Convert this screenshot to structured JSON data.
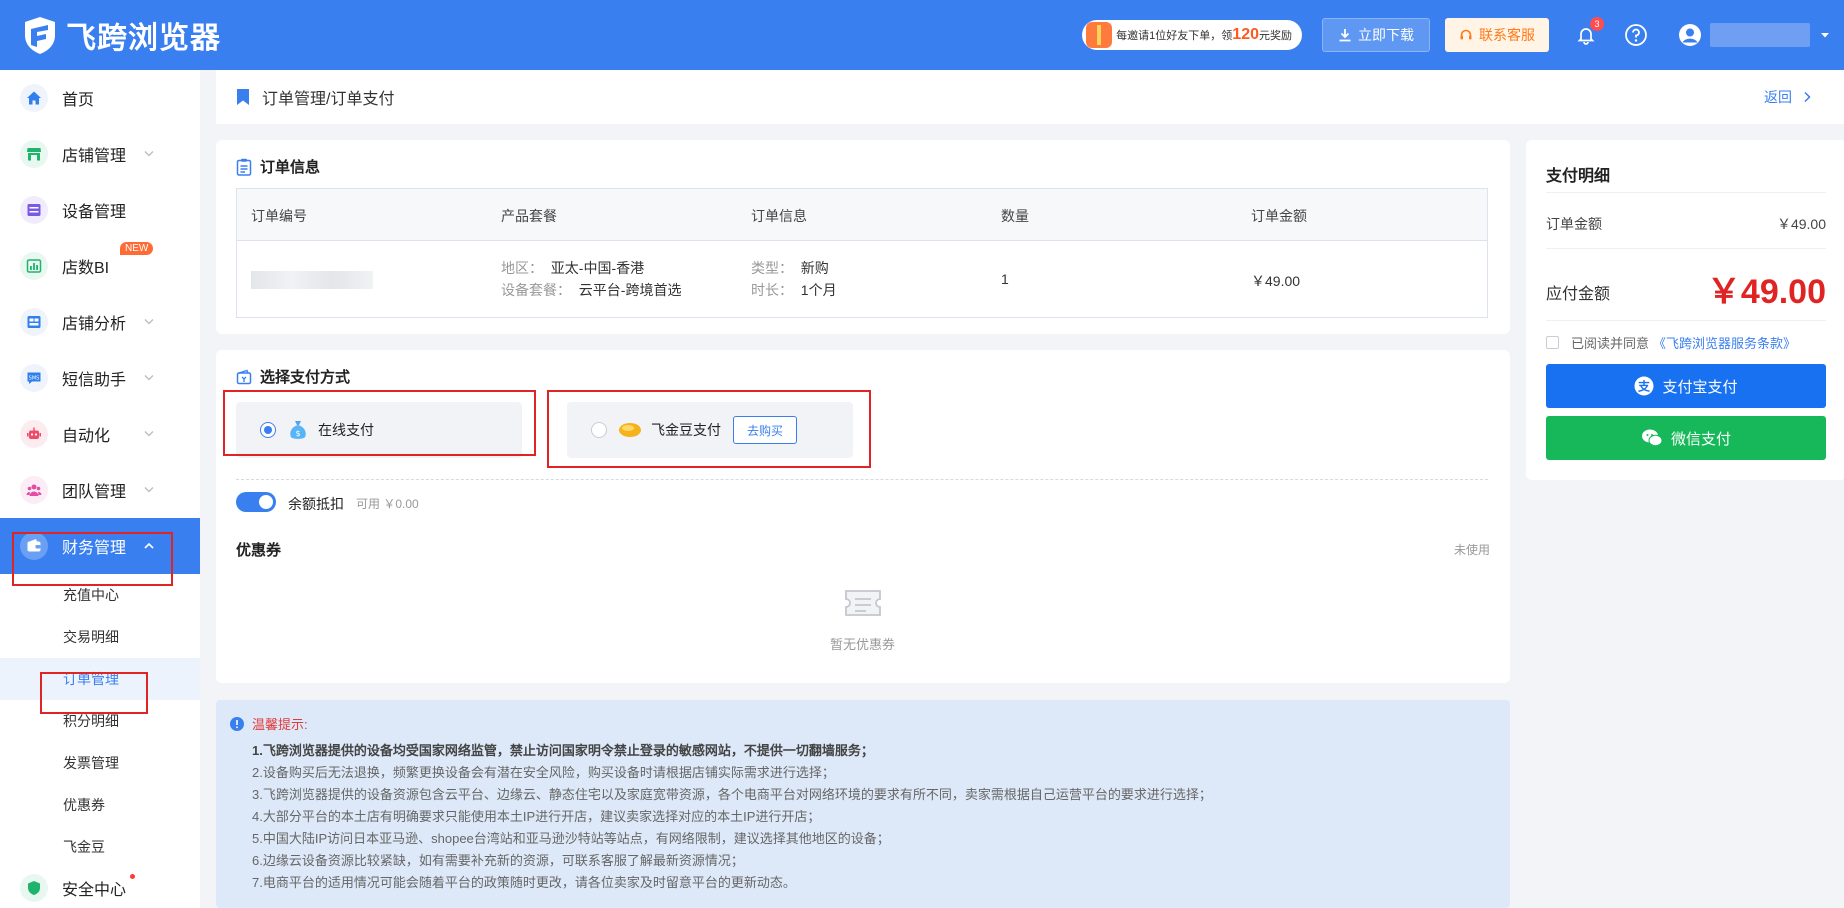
{
  "app": {
    "name": "飞跨浏览器"
  },
  "header": {
    "invite": {
      "prefix": "每邀请1位好友下单，领",
      "amount": "120",
      "suffix": "元奖励"
    },
    "download_label": "立即下载",
    "service_label": "联系客服",
    "notification_count": "3"
  },
  "sidebar": {
    "items": [
      {
        "label": "首页"
      },
      {
        "label": "店铺管理"
      },
      {
        "label": "设备管理"
      },
      {
        "label": "店数BI",
        "badge": "NEW"
      },
      {
        "label": "店铺分析"
      },
      {
        "label": "短信助手"
      },
      {
        "label": "自动化"
      },
      {
        "label": "团队管理"
      },
      {
        "label": "财务管理"
      },
      {
        "label": "安全中心"
      }
    ],
    "finance_sub": [
      {
        "label": "充值中心"
      },
      {
        "label": "交易明细"
      },
      {
        "label": "订单管理"
      },
      {
        "label": "积分明细"
      },
      {
        "label": "发票管理"
      },
      {
        "label": "优惠券"
      },
      {
        "label": "飞金豆"
      }
    ]
  },
  "breadcrumb": {
    "text": "订单管理/订单支付",
    "back_label": "返回"
  },
  "order_info": {
    "title": "订单信息",
    "columns": [
      "订单编号",
      "产品套餐",
      "订单信息",
      "数量",
      "订单金额"
    ],
    "row": {
      "region_key": "地区：",
      "region_value": "亚太-中国-香港",
      "package_key": "设备套餐：",
      "package_value": "云平台-跨境首选",
      "type_key": "类型：",
      "type_value": "新购",
      "duration_key": "时长：",
      "duration_value": "1个月",
      "quantity": "1",
      "amount": "￥49.00"
    }
  },
  "payment_method": {
    "title": "选择支付方式",
    "online_label": "在线支付",
    "bean_label": "飞金豆支付",
    "buy_label": "去购买",
    "balance_label": "余额抵扣",
    "balance_available": "可用 ￥0.00",
    "coupon_title": "优惠券",
    "coupon_status": "未使用",
    "coupon_empty": "暂无优惠券"
  },
  "tips": {
    "title": "温馨提示:",
    "items": [
      "1.飞跨浏览器提供的设备均受国家网络监管，禁止访问国家明令禁止登录的敏感网站，不提供一切翻墙服务；",
      "2.设备购买后无法退换，频繁更换设备会有潜在安全风险，购买设备时请根据店铺实际需求进行选择；",
      "3.飞跨浏览器提供的设备资源包含云平台、边缘云、静态住宅以及家庭宽带资源，各个电商平台对网络环境的要求有所不同，卖家需根据自己运营平台的要求进行选择；",
      "4.大部分平台的本土店有明确要求只能使用本土IP进行开店，建议卖家选择对应的本土IP进行开店；",
      "5.中国大陆IP访问日本亚马逊、shopee台湾站和亚马逊沙特站等站点，有网络限制，建议选择其他地区的设备；",
      "6.边缘云设备资源比较紧缺，如有需要补充新的资源，可联系客服了解最新资源情况；",
      "7.电商平台的适用情况可能会随着平台的政策随时更改，请各位卖家及时留意平台的更新动态。"
    ]
  },
  "payment_detail": {
    "title": "支付明细",
    "order_amount_label": "订单金额",
    "order_amount_value": "￥49.00",
    "payable_label": "应付金额",
    "payable_value": "￥49.00",
    "agree_prefix": "已阅读并同意",
    "agree_link": "《飞跨浏览器服务条款》",
    "alipay_label": "支付宝支付",
    "wechat_label": "微信支付"
  },
  "colors": {
    "brand": "#3a7ff0",
    "price_red": "#e02424",
    "alipay": "#1771f1",
    "wechat": "#17b85a",
    "warning": "#ff7a1a"
  }
}
